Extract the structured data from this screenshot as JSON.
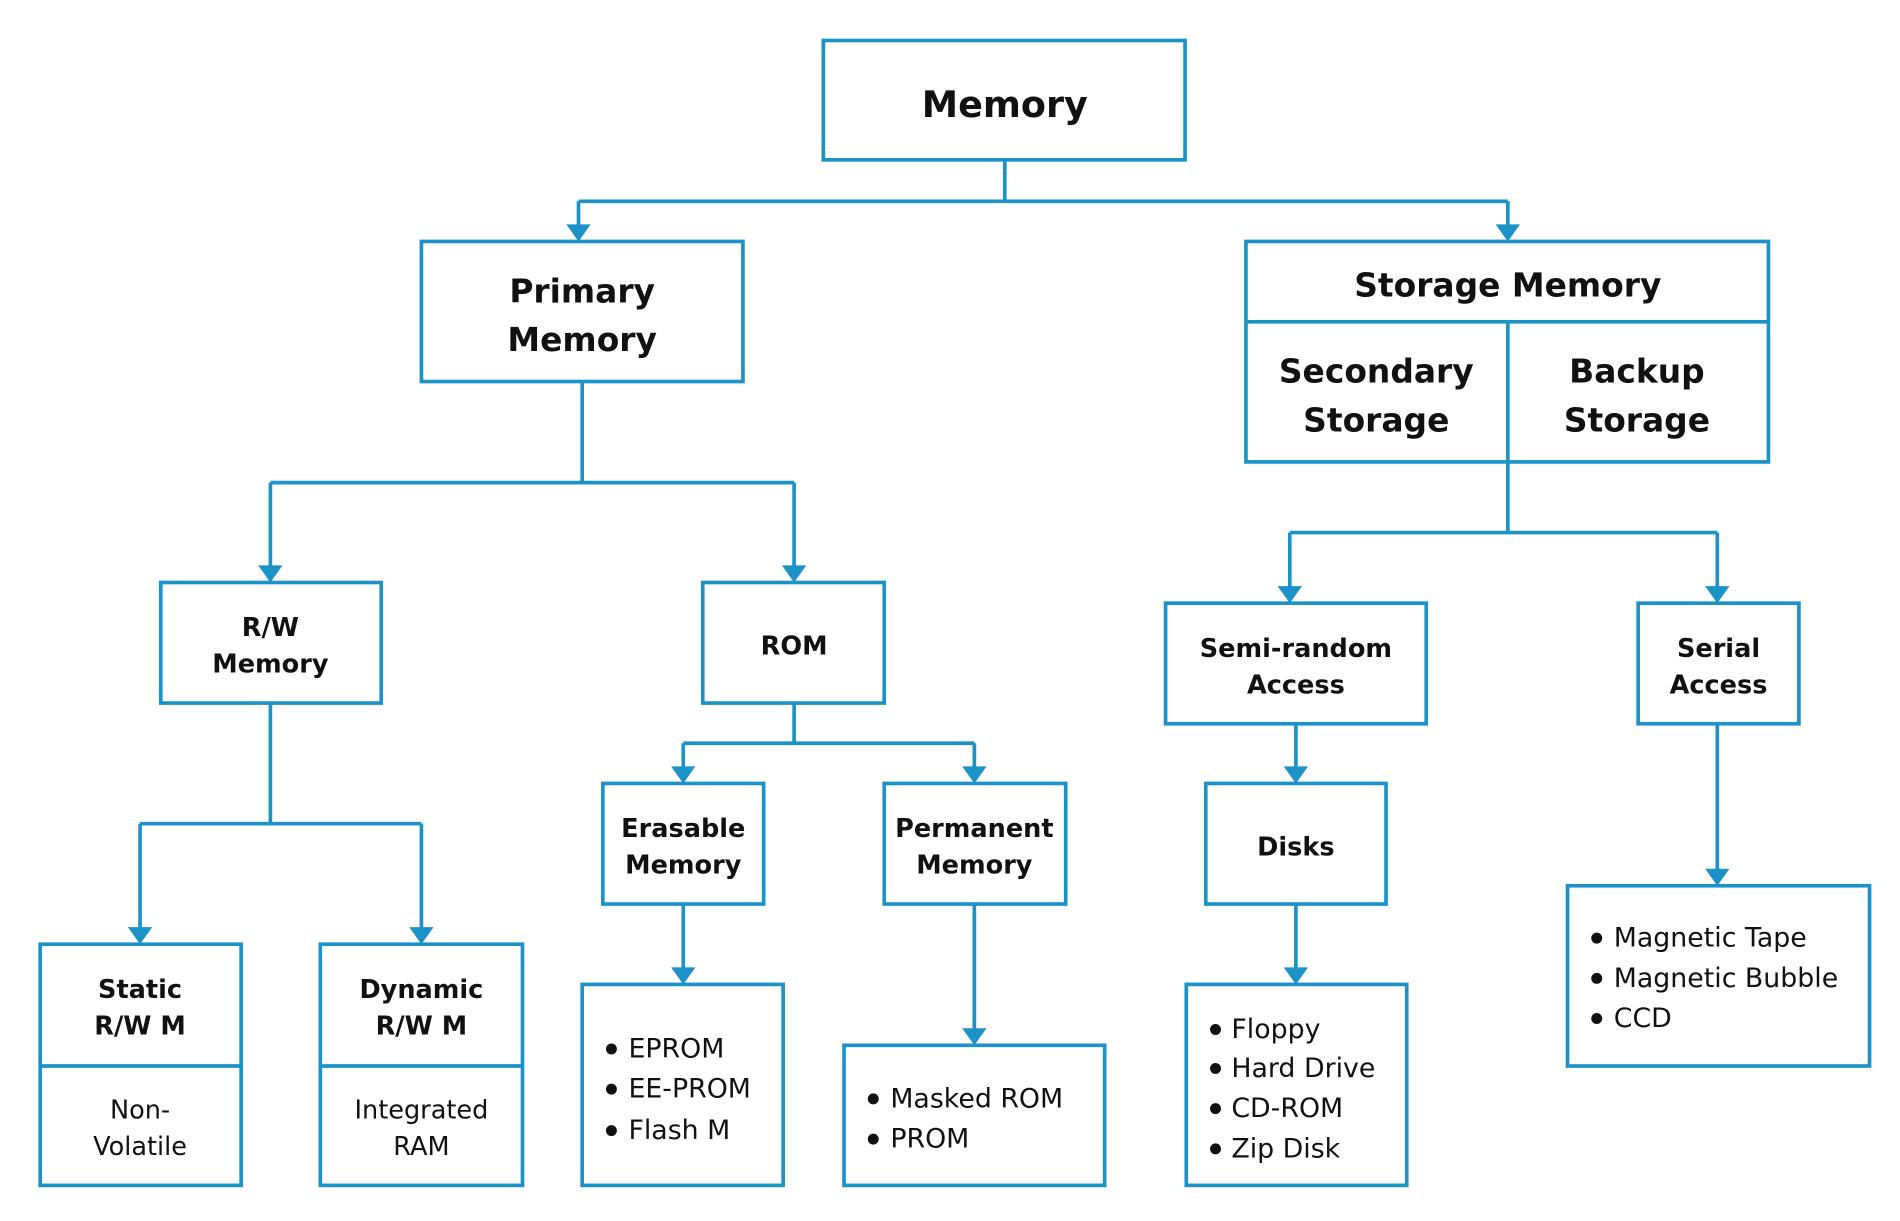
{
  "colors": {
    "accent": "#1b92c8",
    "text": "#111111",
    "background": "#ffffff"
  },
  "nodes": {
    "memory": {
      "lines": [
        "Memory"
      ]
    },
    "primary": {
      "lines": [
        "Primary",
        "Memory"
      ]
    },
    "storage": {
      "title": "Storage Memory",
      "left": [
        "Secondary",
        "Storage"
      ],
      "right": [
        "Backup",
        "Storage"
      ]
    },
    "rw": {
      "lines": [
        "R/W",
        "Memory"
      ]
    },
    "rom": {
      "lines": [
        "ROM"
      ]
    },
    "semirandom": {
      "lines": [
        "Semi-random",
        "Access"
      ]
    },
    "serial": {
      "lines": [
        "Serial",
        "Access"
      ]
    },
    "static": {
      "lines": [
        "Static",
        "R/W M"
      ],
      "sub": [
        "Non-",
        "Volatile"
      ]
    },
    "dynamic": {
      "lines": [
        "Dynamic",
        "R/W M"
      ],
      "sub": [
        "Integrated",
        "RAM"
      ]
    },
    "erasable": {
      "lines": [
        "Erasable",
        "Memory"
      ]
    },
    "permanent": {
      "lines": [
        "Permanent",
        "Memory"
      ]
    },
    "disks": {
      "lines": [
        "Disks"
      ]
    }
  },
  "lists": {
    "erasable": [
      "EPROM",
      "EE-PROM",
      "Flash M"
    ],
    "permanent": [
      "Masked ROM",
      "PROM"
    ],
    "disks": [
      "Floppy",
      "Hard Drive",
      "CD-ROM",
      "Zip Disk"
    ],
    "serial": [
      "Magnetic Tape",
      "Magnetic Bubble",
      "CCD"
    ]
  }
}
